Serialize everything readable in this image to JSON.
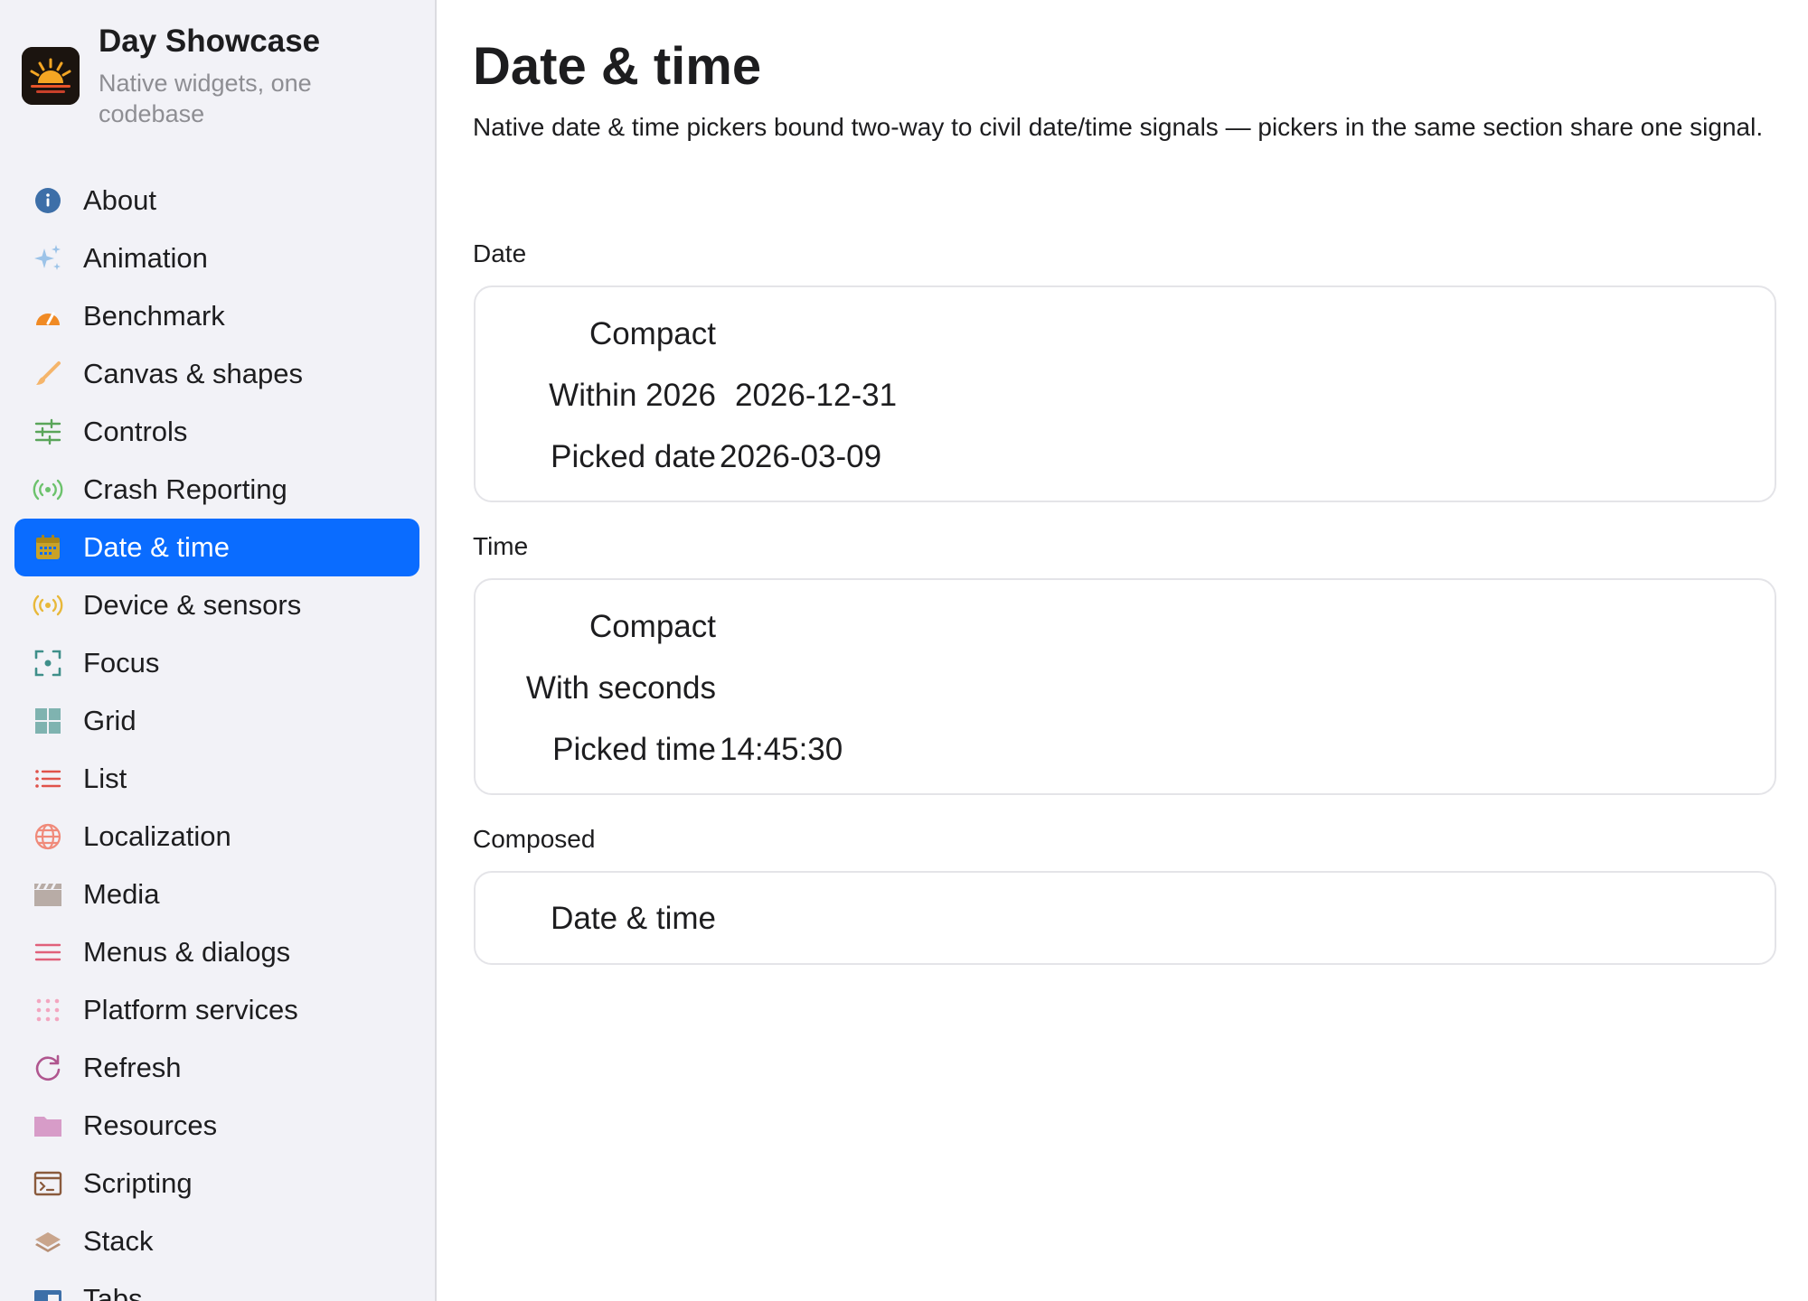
{
  "app": {
    "title": "Day Showcase",
    "subtitle": "Native widgets, one codebase"
  },
  "sidebar": {
    "items": [
      {
        "label": "About",
        "icon": "info-icon",
        "color": "#3d6fa8"
      },
      {
        "label": "Animation",
        "icon": "sparkles-icon",
        "color": "#9cc3e8"
      },
      {
        "label": "Benchmark",
        "icon": "speedometer-icon",
        "color": "#f08a24"
      },
      {
        "label": "Canvas & shapes",
        "icon": "paintbrush-icon",
        "color": "#f5b56b"
      },
      {
        "label": "Controls",
        "icon": "sliders-icon",
        "color": "#5aa55a"
      },
      {
        "label": "Crash Reporting",
        "icon": "broadcast-icon",
        "color": "#6cc26c"
      },
      {
        "label": "Date & time",
        "icon": "calendar-icon",
        "color": "#c9a227",
        "active": true
      },
      {
        "label": "Device & sensors",
        "icon": "broadcast-icon",
        "color": "#e8b83a"
      },
      {
        "label": "Focus",
        "icon": "focus-icon",
        "color": "#3f8f8a"
      },
      {
        "label": "Grid",
        "icon": "grid-icon",
        "color": "#7fb3b0"
      },
      {
        "label": "List",
        "icon": "list-icon",
        "color": "#e0524a"
      },
      {
        "label": "Localization",
        "icon": "globe-icon",
        "color": "#f08a7a"
      },
      {
        "label": "Media",
        "icon": "clapperboard-icon",
        "color": "#b8aca6"
      },
      {
        "label": "Menus & dialogs",
        "icon": "menu-lines-icon",
        "color": "#e0607a"
      },
      {
        "label": "Platform services",
        "icon": "dots-grid-icon",
        "color": "#f3a6c0"
      },
      {
        "label": "Refresh",
        "icon": "refresh-icon",
        "color": "#b0568f"
      },
      {
        "label": "Resources",
        "icon": "folder-icon",
        "color": "#d79cc8"
      },
      {
        "label": "Scripting",
        "icon": "terminal-icon",
        "color": "#8a5a3c"
      },
      {
        "label": "Stack",
        "icon": "stack-icon",
        "color": "#c9a58c"
      },
      {
        "label": "Tabs",
        "icon": "tabs-icon",
        "color": "#3d6fa8"
      }
    ]
  },
  "main": {
    "title": "Date & time",
    "description": "Native date & time pickers bound two-way to civil date/time signals — pickers in the same section share one signal.",
    "sections": {
      "date": {
        "label": "Date",
        "rows": {
          "compact": {
            "label": "Compact",
            "value": ""
          },
          "within": {
            "label": "Within 2026",
            "value": "2026-12-31"
          },
          "picked": {
            "label": "Picked date",
            "value": "2026-03-09"
          }
        }
      },
      "time": {
        "label": "Time",
        "rows": {
          "compact": {
            "label": "Compact",
            "value": ""
          },
          "seconds": {
            "label": "With seconds",
            "value": ""
          },
          "picked": {
            "label": "Picked time",
            "value": "14:45:30"
          }
        }
      },
      "composed": {
        "label": "Composed",
        "rows": {
          "datetime": {
            "label": "Date & time",
            "value": ""
          }
        }
      }
    }
  }
}
